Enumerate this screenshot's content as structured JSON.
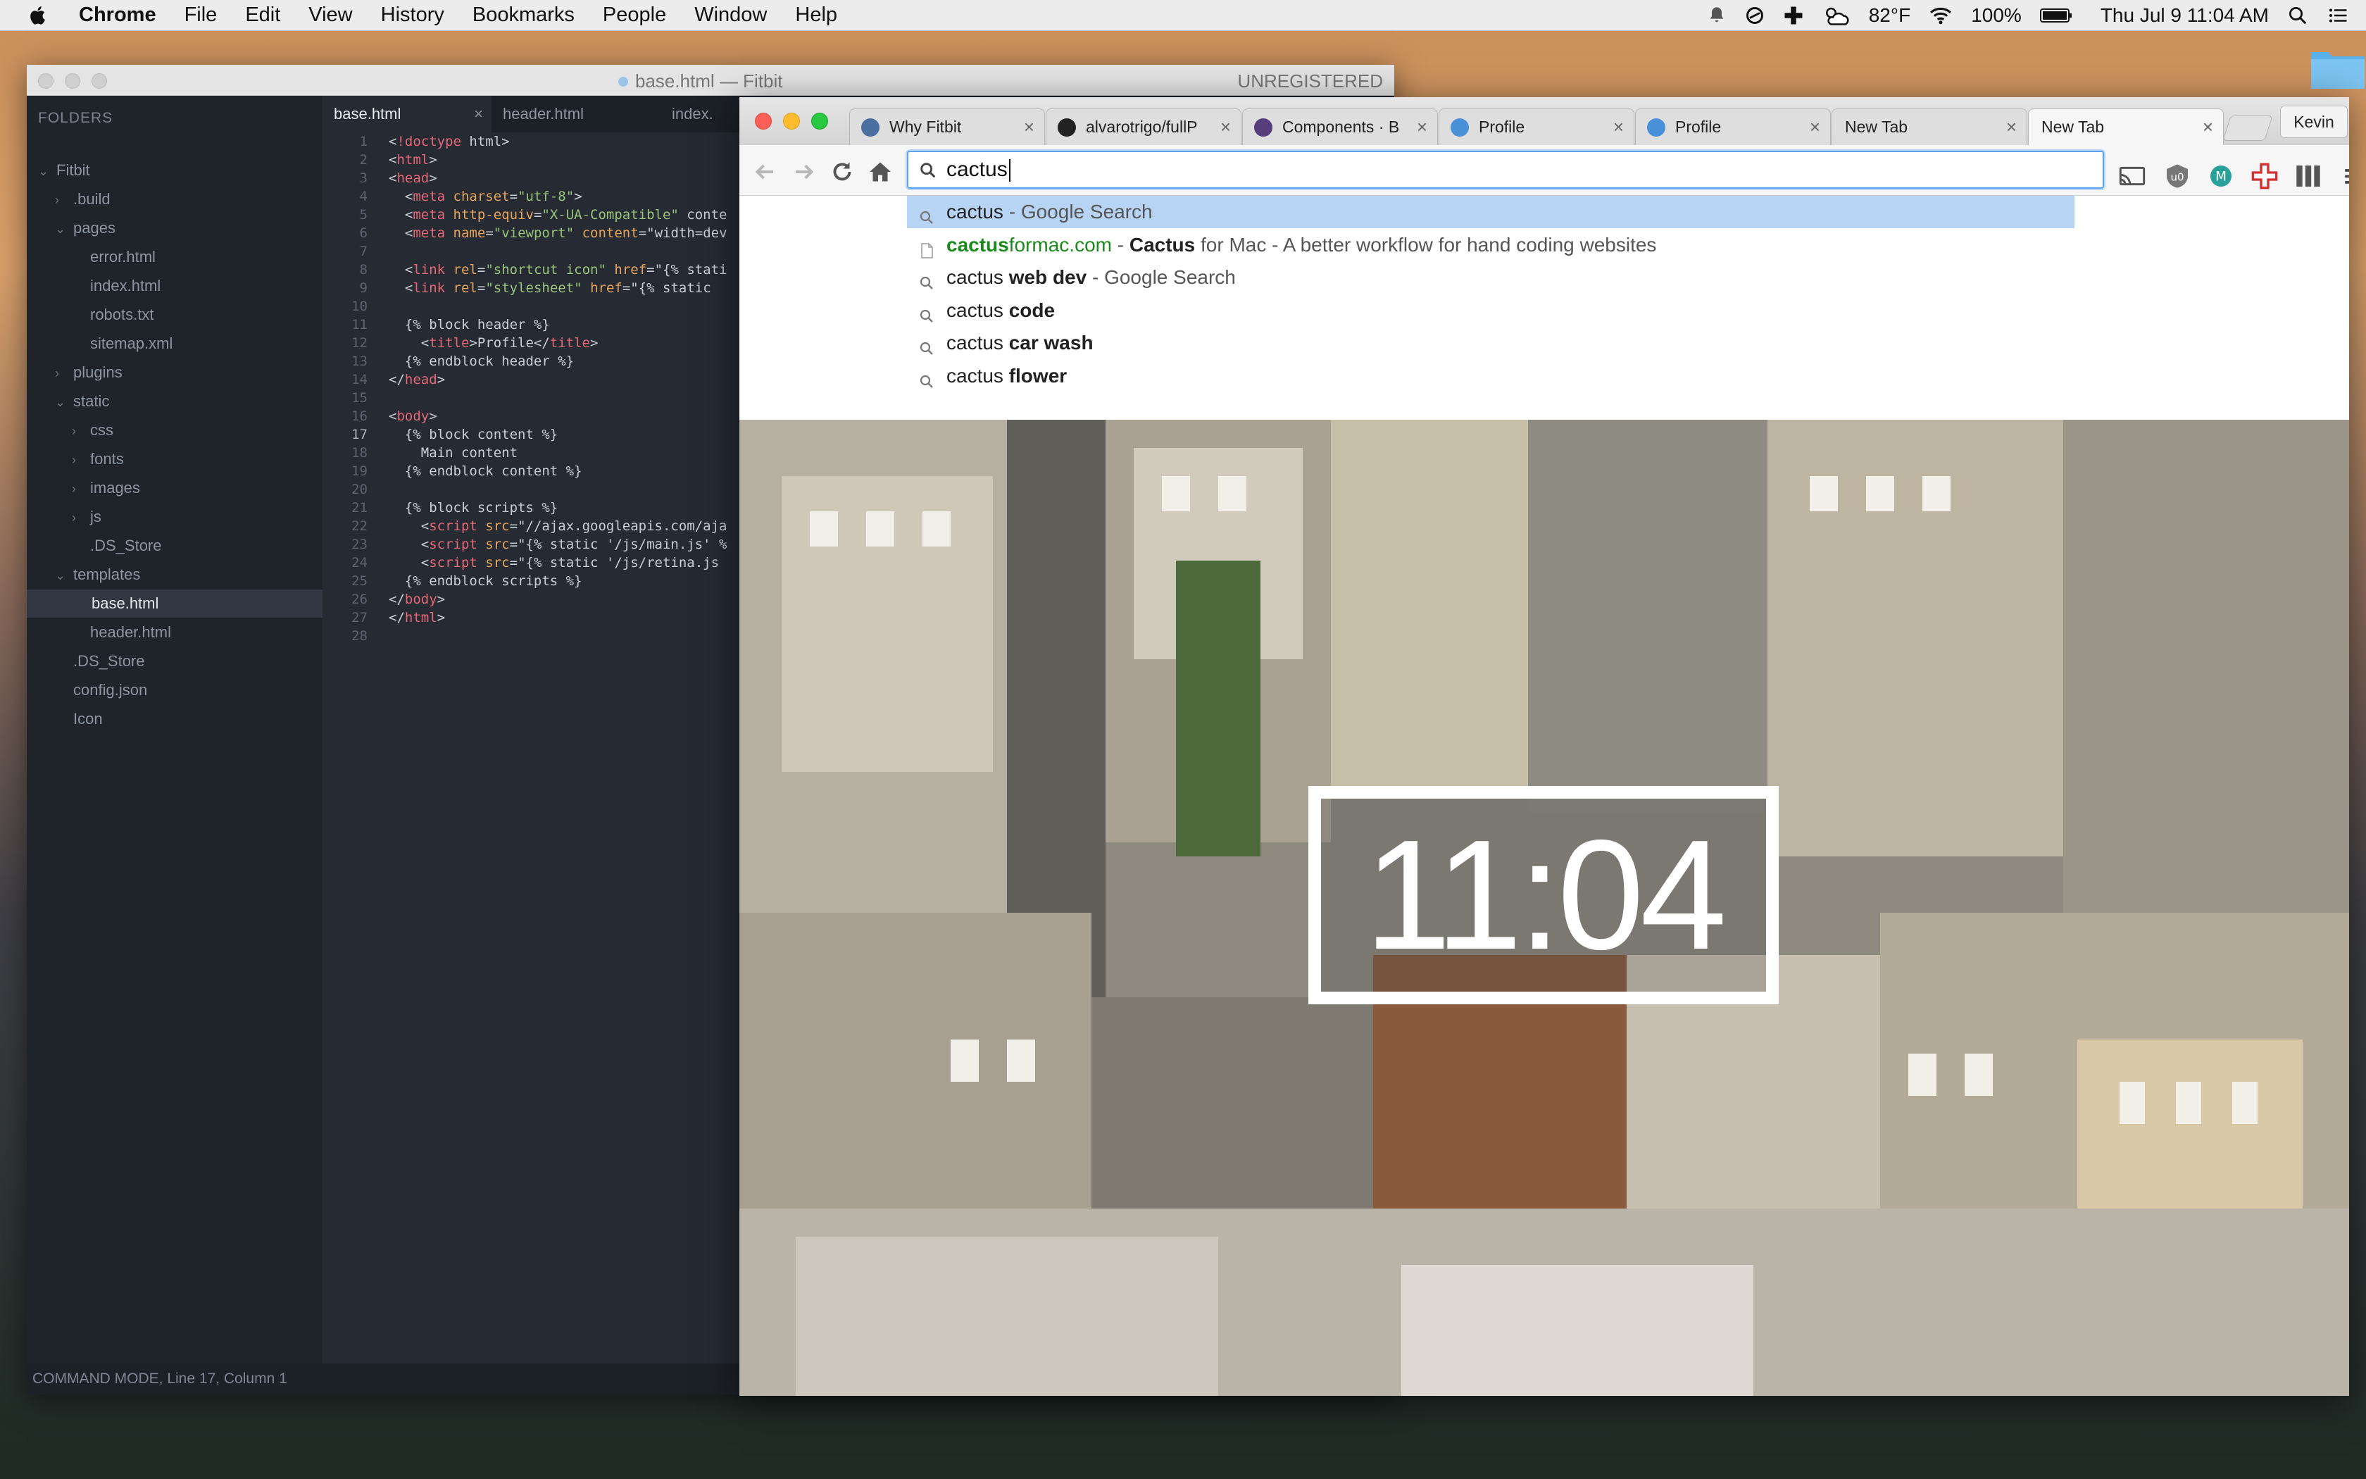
{
  "menubar": {
    "app_name": "Chrome",
    "menus": [
      "File",
      "Edit",
      "View",
      "History",
      "Bookmarks",
      "People",
      "Window",
      "Help"
    ],
    "weather": "82°F",
    "battery": "100%",
    "datetime": "Thu Jul 9  11:04 AM"
  },
  "sublime": {
    "title": "base.html — Fitbit",
    "unregistered": "UNREGISTERED",
    "folders_label": "FOLDERS",
    "tree": [
      {
        "label": "Fitbit",
        "depth": 0,
        "arrow": "open"
      },
      {
        "label": ".build",
        "depth": 1,
        "arrow": "closed"
      },
      {
        "label": "pages",
        "depth": 1,
        "arrow": "open"
      },
      {
        "label": "error.html",
        "depth": 2,
        "arrow": ""
      },
      {
        "label": "index.html",
        "depth": 2,
        "arrow": ""
      },
      {
        "label": "robots.txt",
        "depth": 2,
        "arrow": ""
      },
      {
        "label": "sitemap.xml",
        "depth": 2,
        "arrow": ""
      },
      {
        "label": "plugins",
        "depth": 1,
        "arrow": "closed"
      },
      {
        "label": "static",
        "depth": 1,
        "arrow": "open"
      },
      {
        "label": "css",
        "depth": 2,
        "arrow": "closed"
      },
      {
        "label": "fonts",
        "depth": 2,
        "arrow": "closed"
      },
      {
        "label": "images",
        "depth": 2,
        "arrow": "closed"
      },
      {
        "label": "js",
        "depth": 2,
        "arrow": "closed"
      },
      {
        "label": ".DS_Store",
        "depth": 2,
        "arrow": ""
      },
      {
        "label": "templates",
        "depth": 1,
        "arrow": "open"
      },
      {
        "label": "base.html",
        "depth": 2,
        "arrow": "",
        "active": true
      },
      {
        "label": "header.html",
        "depth": 2,
        "arrow": ""
      },
      {
        "label": ".DS_Store",
        "depth": 1,
        "arrow": ""
      },
      {
        "label": "config.json",
        "depth": 1,
        "arrow": ""
      },
      {
        "label": "Icon",
        "depth": 1,
        "arrow": ""
      }
    ],
    "tabs": [
      {
        "label": "base.html",
        "active": true
      },
      {
        "label": "header.html",
        "active": false
      },
      {
        "label": "index.",
        "active": false
      }
    ],
    "code_lines": [
      "<!doctype html>",
      "<html>",
      "<head>",
      "  <meta charset=\"utf-8\">",
      "  <meta http-equiv=\"X-UA-Compatible\" conte",
      "  <meta name=\"viewport\" content=\"width=dev",
      "",
      "  <link rel=\"shortcut icon\" href=\"{% stati",
      "  <link rel=\"stylesheet\" href=\"{% static ",
      "",
      "  {% block header %}",
      "    <title>Profile</title>",
      "  {% endblock header %}",
      "</head>",
      "",
      "<body>",
      "  {% block content %}",
      "    Main content",
      "  {% endblock content %}",
      "",
      "  {% block scripts %}",
      "    <script src=\"//ajax.googleapis.com/aja",
      "    <script src=\"{% static '/js/main.js' %",
      "    <script src=\"{% static '/js/retina.js",
      "  {% endblock scripts %}",
      "</body>",
      "</html>",
      ""
    ],
    "status": "COMMAND MODE, Line 17, Column 1"
  },
  "chrome": {
    "tabs": [
      {
        "label": "Why Fitbit",
        "favicon_color": "#4a6fa0",
        "active": false
      },
      {
        "label": "alvarotrigo/fullP",
        "favicon_color": "#222222",
        "active": false
      },
      {
        "label": "Components · B",
        "favicon_color": "#563d7c",
        "active": false
      },
      {
        "label": "Profile",
        "favicon_color": "#4a90d9",
        "active": false
      },
      {
        "label": "Profile",
        "favicon_color": "#4a90d9",
        "active": false
      },
      {
        "label": "New Tab",
        "favicon_color": "",
        "active": false
      },
      {
        "label": "New Tab",
        "favicon_color": "",
        "active": true
      }
    ],
    "profile_name": "Kevin",
    "omnibox_value": "cactus",
    "suggestions": [
      {
        "type": "search",
        "parts": [
          {
            "t": "cactus",
            "s": "n"
          },
          {
            "t": " - Google Search",
            "s": "m"
          }
        ],
        "selected": true
      },
      {
        "type": "page",
        "parts": [
          {
            "t": "cactus",
            "s": "ub"
          },
          {
            "t": "formac.com",
            "s": "u"
          },
          {
            "t": " - ",
            "s": "m"
          },
          {
            "t": "Cactus",
            "s": "b"
          },
          {
            "t": " for Mac - A better workflow for hand coding websites",
            "s": "m"
          }
        ],
        "selected": false
      },
      {
        "type": "search",
        "parts": [
          {
            "t": "cactus ",
            "s": "n"
          },
          {
            "t": "web dev",
            "s": "b"
          },
          {
            "t": " - Google Search",
            "s": "m"
          }
        ],
        "selected": false
      },
      {
        "type": "search",
        "parts": [
          {
            "t": "cactus ",
            "s": "n"
          },
          {
            "t": "code",
            "s": "b"
          }
        ],
        "selected": false
      },
      {
        "type": "search",
        "parts": [
          {
            "t": "cactus ",
            "s": "n"
          },
          {
            "t": "car wash",
            "s": "b"
          }
        ],
        "selected": false
      },
      {
        "type": "search",
        "parts": [
          {
            "t": "cactus ",
            "s": "n"
          },
          {
            "t": "flower",
            "s": "b"
          }
        ],
        "selected": false
      }
    ],
    "clock": "11:04"
  }
}
